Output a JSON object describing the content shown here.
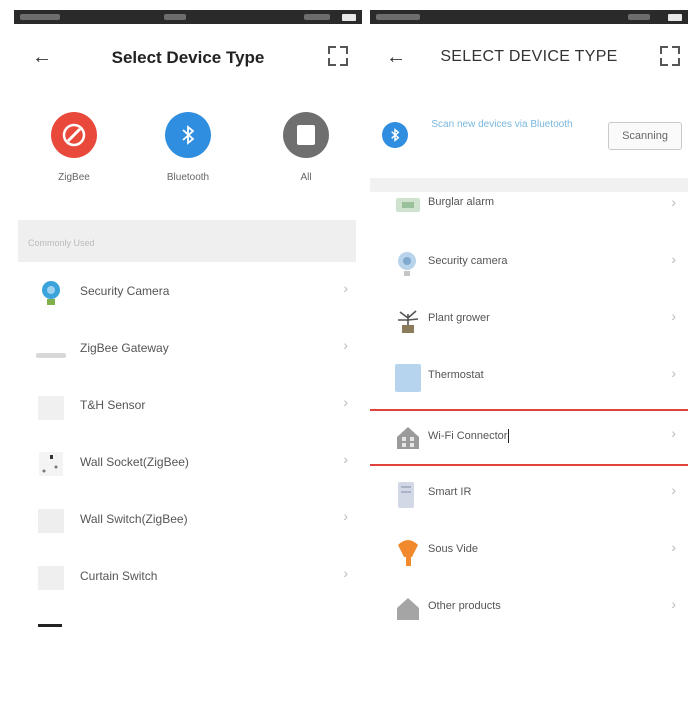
{
  "left": {
    "title": "Select Device Type",
    "methods": [
      {
        "label": "ZigBee",
        "color": "#e8493a",
        "icon": "zigbee-icon"
      },
      {
        "label": "Bluetooth",
        "color": "#2f8ee0",
        "icon": "bluetooth-icon"
      },
      {
        "label": "All",
        "color": "#6f6f6f",
        "icon": "all-icon"
      }
    ],
    "section_label": "Commonly Used",
    "items": [
      {
        "label": "Security Camera",
        "icon": "camera-icon"
      },
      {
        "label": "ZigBee Gateway",
        "icon": "gateway-icon"
      },
      {
        "label": "T&H Sensor",
        "icon": "sensor-icon"
      },
      {
        "label": "Wall Socket(ZigBee)",
        "icon": "socket-icon"
      },
      {
        "label": "Wall Switch(ZigBee)",
        "icon": "switch-icon"
      },
      {
        "label": "Curtain Switch",
        "icon": "curtain-icon"
      }
    ]
  },
  "right": {
    "title": "SELECT DEVICE TYPE",
    "bluetooth_hint": "Scan new devices via Bluetooth",
    "scan_button": "Scanning",
    "items": [
      {
        "label": "Burglar alarm",
        "icon": "alarm-icon"
      },
      {
        "label": "Security camera",
        "icon": "camera-icon"
      },
      {
        "label": "Plant grower",
        "icon": "plant-icon"
      },
      {
        "label": "Thermostat",
        "icon": "thermostat-icon"
      },
      {
        "label": "Wi-Fi Connector",
        "icon": "home-icon"
      },
      {
        "label": "Smart IR",
        "icon": "ir-icon"
      },
      {
        "label": "Sous Vide",
        "icon": "sous-vide-icon"
      },
      {
        "label": "Other products",
        "icon": "other-icon"
      }
    ],
    "highlighted_item": "Wi-Fi Connector"
  },
  "colors": {
    "zigbee": "#e8493a",
    "bluetooth": "#2f8ee0",
    "highlight": "#e0423c"
  }
}
